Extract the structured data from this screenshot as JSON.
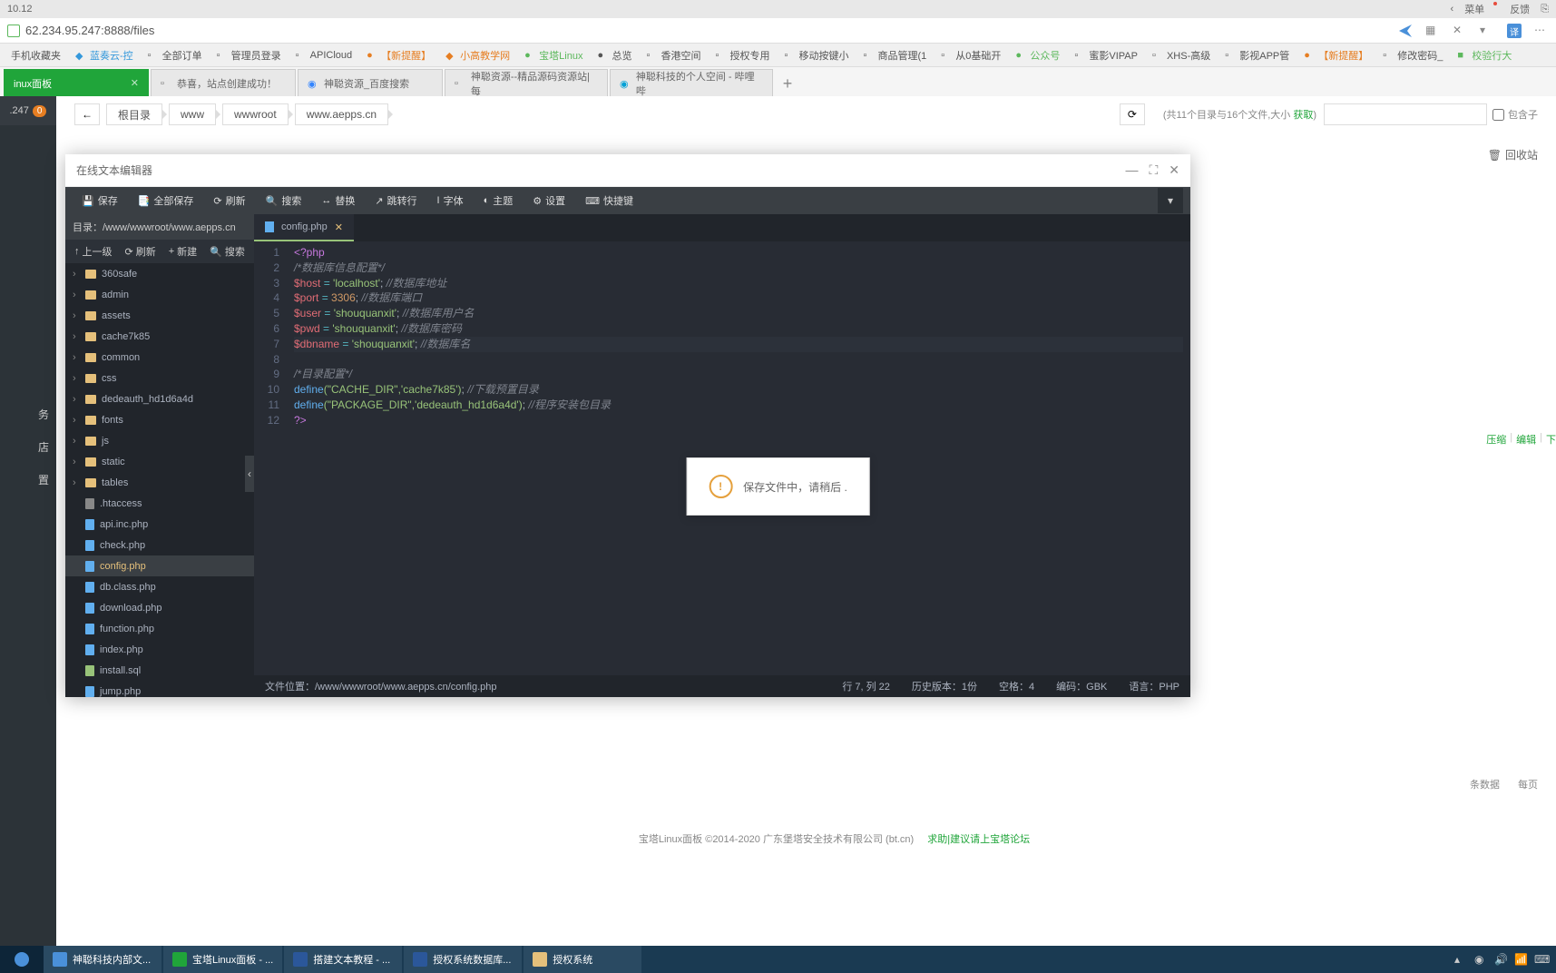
{
  "browser_top": {
    "left": "10.12",
    "menu": "菜单",
    "feedback": "反馈"
  },
  "address": {
    "url": "62.234.95.247:8888/files"
  },
  "bookmarks": [
    {
      "label": "手机收藏夹"
    },
    {
      "label": "蓝奏云-控"
    },
    {
      "label": "全部订单"
    },
    {
      "label": "管理员登录"
    },
    {
      "label": "APICloud"
    },
    {
      "label": "【新提醒】"
    },
    {
      "label": "小高教学网"
    },
    {
      "label": "宝塔Linux"
    },
    {
      "label": "总览"
    },
    {
      "label": "香港空间"
    },
    {
      "label": "授权专用"
    },
    {
      "label": "移动按键小"
    },
    {
      "label": "商品管理(1"
    },
    {
      "label": "从0基础开"
    },
    {
      "label": "公众号"
    },
    {
      "label": "蜜影VIPAP"
    },
    {
      "label": "XHS-高级"
    },
    {
      "label": "影视APP管"
    },
    {
      "label": "【新提醒】"
    },
    {
      "label": "修改密码_"
    },
    {
      "label": "校验行大"
    }
  ],
  "tabs": [
    {
      "label": "inux面板",
      "active": true
    },
    {
      "label": "恭喜，站点创建成功！"
    },
    {
      "label": "神聪资源_百度搜索"
    },
    {
      "label": "神聪资源--精品源码资源站|每"
    },
    {
      "label": "神聪科技的个人空间 - 哔哩哔"
    }
  ],
  "sidebar_top": {
    "label": ".247",
    "badge": "0"
  },
  "sidebar_menu": [
    "务",
    "店",
    "置"
  ],
  "breadcrumb": {
    "back": "←",
    "segments": [
      "根目录",
      "www",
      "wwwroot",
      "www.aepps.cn"
    ],
    "info_prefix": "(共11个目录与16个文件,大小 ",
    "info_link": "获取",
    "info_suffix": ")",
    "search_placeholder": "",
    "include_children": "包含子"
  },
  "recycle": "回收站",
  "editor": {
    "title": "在线文本编辑器",
    "toolbar": {
      "save": "保存",
      "saveall": "全部保存",
      "refresh": "刷新",
      "search": "搜索",
      "replace": "替换",
      "jump": "跳转行",
      "font": "字体",
      "theme": "主题",
      "settings": "设置",
      "shortcut": "快捷键"
    },
    "tree_path": "目录：/www/wwwroot/www.aepps.cn",
    "tree_actions": {
      "up": "上一级",
      "refresh": "刷新",
      "new": "新建",
      "search": "搜索"
    },
    "tree_items": [
      {
        "name": "360safe",
        "type": "folder"
      },
      {
        "name": "admin",
        "type": "folder"
      },
      {
        "name": "assets",
        "type": "folder"
      },
      {
        "name": "cache7k85",
        "type": "folder"
      },
      {
        "name": "common",
        "type": "folder"
      },
      {
        "name": "css",
        "type": "folder"
      },
      {
        "name": "dedeauth_hd1d6a4d",
        "type": "folder"
      },
      {
        "name": "fonts",
        "type": "folder"
      },
      {
        "name": "js",
        "type": "folder"
      },
      {
        "name": "static",
        "type": "folder"
      },
      {
        "name": "tables",
        "type": "folder"
      },
      {
        "name": ".htaccess",
        "type": "ht"
      },
      {
        "name": "api.inc.php",
        "type": "file"
      },
      {
        "name": "check.php",
        "type": "file"
      },
      {
        "name": "config.php",
        "type": "file",
        "active": true
      },
      {
        "name": "db.class.php",
        "type": "file"
      },
      {
        "name": "download.php",
        "type": "file"
      },
      {
        "name": "function.php",
        "type": "file"
      },
      {
        "name": "index.php",
        "type": "file"
      },
      {
        "name": "install.sql",
        "type": "sql"
      },
      {
        "name": "jump.php",
        "type": "file"
      }
    ],
    "code_tab": "config.php",
    "code": {
      "l1": "<?php",
      "l2": "/*数据库信息配置*/",
      "l3_var": "$host",
      "l3_op": " = ",
      "l3_str": "'localhost'",
      "l3_end": "; ",
      "l3_cmt": "//数据库地址",
      "l4_var": "$port",
      "l4_op": " = ",
      "l4_num": "3306",
      "l4_end": "; ",
      "l4_cmt": "//数据库端口",
      "l5_var": "$user",
      "l5_op": " = ",
      "l5_str": "'shouquanxit'",
      "l5_end": "; ",
      "l5_cmt": "//数据库用户名",
      "l6_var": "$pwd",
      "l6_op": " = ",
      "l6_str": "'shouquanxit'",
      "l6_end": "; ",
      "l6_cmt": "//数据库密码",
      "l7_var": "$dbname",
      "l7_op": " = ",
      "l7_str": "'shouquanxit'",
      "l7_end": "; ",
      "l7_cmt": "//数据库名",
      "l9": "/*目录配置*/",
      "l10_fn": "define",
      "l10_args": "(\"CACHE_DIR\",'cache7k85')",
      "l10_end": "; ",
      "l10_cmt": "//下载预置目录",
      "l11_fn": "define",
      "l11_args": "(\"PACKAGE_DIR\",'dedeauth_hd1d6a4d')",
      "l11_end": "; ",
      "l11_cmt": "//程序安装包目录",
      "l12": "?>"
    },
    "status": {
      "filepath": "文件位置：/www/wwwroot/www.aepps.cn/config.php",
      "cursor": "行 7, 列 22",
      "history": "历史版本：1份",
      "spaces": "空格：4",
      "encoding": "编码：GBK",
      "lang": "语言：PHP"
    }
  },
  "toast": "保存文件中，请稍后  .",
  "right_peek": [
    "压缩",
    "编辑",
    "下"
  ],
  "bottom_peek": [
    "条数据",
    "每页"
  ],
  "footer": {
    "copyright": "宝塔Linux面板 ©2014-2020 广东堡塔安全技术有限公司 (bt.cn)",
    "link": "求助|建议请上宝塔论坛"
  },
  "taskbar": [
    {
      "label": "神聪科技内部文..."
    },
    {
      "label": "宝塔Linux面板 - ..."
    },
    {
      "label": "搭建文本教程 - ..."
    },
    {
      "label": "授权系统数据库..."
    },
    {
      "label": "授权系统"
    }
  ]
}
